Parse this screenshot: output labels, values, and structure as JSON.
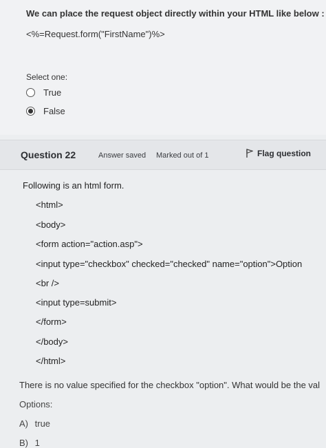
{
  "prev_question": {
    "text": "We can place the request object directly within your HTML like below :",
    "code": "<%=Request.form(\"FirstName\")%>",
    "select_label": "Select one:",
    "options": [
      {
        "label": "True",
        "selected": false
      },
      {
        "label": "False",
        "selected": true
      }
    ]
  },
  "question": {
    "number": "Question 22",
    "status": "Answer saved",
    "marks": "Marked out of 1",
    "flag_label": "Flag question",
    "intro": "Following is an html form.",
    "code_lines": [
      "<html>",
      "<body>",
      "<form action=\"action.asp\">",
      "<input type=\"checkbox\" checked=\"checked\" name=\"option\">Option",
      "<br />",
      "<input type=submit>",
      "</form>",
      "</body>",
      "</html>"
    ],
    "prompt": "There is no value specified for the checkbox \"option\". What would be the val",
    "options_label": "Options:",
    "answers": [
      {
        "letter": "A)",
        "text": "true"
      },
      {
        "letter": "B)",
        "text": "1"
      }
    ]
  }
}
